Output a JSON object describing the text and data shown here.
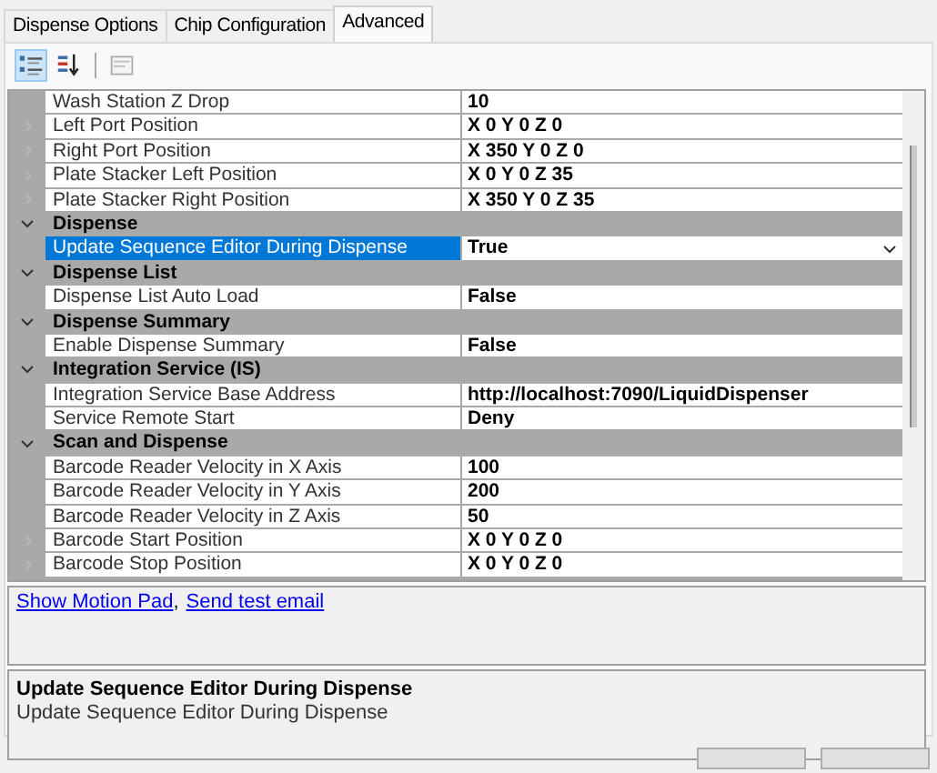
{
  "tabs": [
    {
      "label": "Dispense Options",
      "selected": false
    },
    {
      "label": "Chip Configuration",
      "selected": false
    },
    {
      "label": "Advanced",
      "selected": true
    }
  ],
  "toolbar": [
    {
      "kind": "categorized",
      "selected": true
    },
    {
      "kind": "alphabetical",
      "selected": false
    },
    {
      "kind": "property-pages",
      "selected": false
    }
  ],
  "property_grid": {
    "rows": [
      {
        "kind": "property",
        "name": "Wash Station Z Drop",
        "value": "10",
        "expandable": false,
        "selected": false
      },
      {
        "kind": "property",
        "name": "Left Port Position",
        "value": "X 0 Y 0 Z 0",
        "expandable": true,
        "selected": false
      },
      {
        "kind": "property",
        "name": "Right Port Position",
        "value": "X 350 Y 0 Z 0",
        "expandable": true,
        "selected": false
      },
      {
        "kind": "property",
        "name": "Plate Stacker Left Position",
        "value": "X 0 Y 0 Z 35",
        "expandable": true,
        "selected": false
      },
      {
        "kind": "property",
        "name": "Plate Stacker Right Position",
        "value": "X 350 Y 0 Z 35",
        "expandable": true,
        "selected": false
      },
      {
        "kind": "category",
        "label": "Dispense",
        "expanded": true
      },
      {
        "kind": "property",
        "name": "Update Sequence Editor During Dispense",
        "value": "True",
        "expandable": false,
        "selected": true
      },
      {
        "kind": "category",
        "label": "Dispense List",
        "expanded": true
      },
      {
        "kind": "property",
        "name": "Dispense List Auto Load",
        "value": "False",
        "expandable": false,
        "selected": false
      },
      {
        "kind": "category",
        "label": "Dispense Summary",
        "expanded": true
      },
      {
        "kind": "property",
        "name": "Enable Dispense Summary",
        "value": "False",
        "expandable": false,
        "selected": false
      },
      {
        "kind": "category",
        "label": "Integration Service (IS)",
        "expanded": true
      },
      {
        "kind": "property",
        "name": "Integration Service Base Address",
        "value": "http://localhost:7090/LiquidDispenser",
        "expandable": false,
        "selected": false
      },
      {
        "kind": "property",
        "name": "Service Remote Start",
        "value": "Deny",
        "expandable": false,
        "selected": false
      },
      {
        "kind": "category",
        "label": "Scan and Dispense",
        "expanded": true
      },
      {
        "kind": "property",
        "name": "Barcode Reader Velocity in X Axis",
        "value": "100",
        "expandable": false,
        "selected": false
      },
      {
        "kind": "property",
        "name": "Barcode Reader Velocity in Y Axis",
        "value": "200",
        "expandable": false,
        "selected": false
      },
      {
        "kind": "property",
        "name": "Barcode Reader Velocity in Z Axis",
        "value": "50",
        "expandable": false,
        "selected": false
      },
      {
        "kind": "property",
        "name": "Barcode Start Position",
        "value": "X 0 Y 0 Z 0",
        "expandable": true,
        "selected": false
      },
      {
        "kind": "property",
        "name": "Barcode Stop Position",
        "value": "X 0 Y 0 Z 0",
        "expandable": true,
        "selected": false
      }
    ]
  },
  "commands": [
    "Show Motion Pad",
    "Send test email"
  ],
  "command_separator": ",",
  "description": {
    "title": "Update Sequence Editor During Dispense",
    "text": "Update Sequence Editor During Dispense"
  }
}
